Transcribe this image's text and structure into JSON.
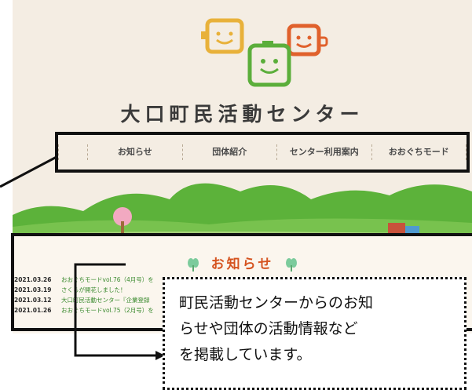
{
  "site": {
    "title": "大口町民活動センター"
  },
  "nav": {
    "items": [
      {
        "label": "お知らせ"
      },
      {
        "label": "団体紹介"
      },
      {
        "label": "センター利用案内"
      },
      {
        "label": "おおぐちモード"
      }
    ]
  },
  "news": {
    "heading": "お知らせ",
    "items": [
      {
        "date": "2021.03.26",
        "title": "おおぐちモードvol.76（4月号）を"
      },
      {
        "date": "2021.03.19",
        "title": "さくらが開花しました！"
      },
      {
        "date": "2021.03.12",
        "title": "大口町民活動センター『企業登録"
      },
      {
        "date": "2021.01.26",
        "title": "おおぐちモードvol.75（2月号）を"
      }
    ]
  },
  "callout": {
    "lines": [
      "町民活動センターからのお知",
      "らせや団体の活動情報など",
      "を掲載しています。"
    ]
  },
  "colors": {
    "page_bg": "#f4ede3",
    "news_heading": "#d5531f",
    "news_title": "#3a8a2e",
    "hill_green": "#5cb23a"
  }
}
